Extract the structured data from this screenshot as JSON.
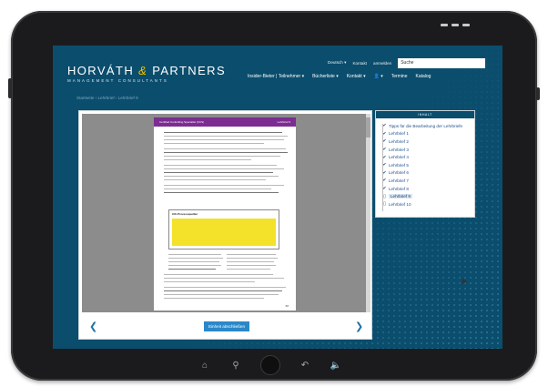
{
  "brand": {
    "name_left": "HORVÁTH",
    "ampersand": "&",
    "name_right": "PARTNERS",
    "tagline": "MANAGEMENT CONSULTANTS"
  },
  "utility": {
    "items": [
      "Deutsch ▾",
      "Kontakt",
      "anmelden"
    ],
    "search_value": "Suche"
  },
  "nav": {
    "items": [
      "Insider-Bieter | Teilnehmer ▾",
      "Bücherliste ▾",
      "Kontakt ▾",
      "👤 ▾",
      "Termine",
      "Katalog"
    ]
  },
  "breadcrumb": "Startseite › Lehrbrief › Lehrbrief 9",
  "document": {
    "header_left": "Certified Controlling Specialist (CCS)",
    "header_right": "Lehrbrief 9",
    "table_title": "CIC-Prozessquellen",
    "page_number": "88"
  },
  "viewer_footer": {
    "prev_icon": "chevron-left",
    "next_icon": "chevron-right",
    "submit_label": "Einheit abschließen"
  },
  "toc": {
    "header": "INHALT",
    "items": [
      {
        "label": "Tipps für die Bearbeitung der Lehrbriefe",
        "checked": true,
        "active": false
      },
      {
        "label": "Lehrbrief 1",
        "checked": true,
        "active": false
      },
      {
        "label": "Lehrbrief 2",
        "checked": true,
        "active": false
      },
      {
        "label": "Lehrbrief 3",
        "checked": true,
        "active": false
      },
      {
        "label": "Lehrbrief 4",
        "checked": true,
        "active": false
      },
      {
        "label": "Lehrbrief 5",
        "checked": true,
        "active": false
      },
      {
        "label": "Lehrbrief 6",
        "checked": true,
        "active": false
      },
      {
        "label": "Lehrbrief 7",
        "checked": true,
        "active": false
      },
      {
        "label": "Lehrbrief 8",
        "checked": true,
        "active": false
      },
      {
        "label": "Lehrbrief 9",
        "checked": false,
        "active": true
      },
      {
        "label": "Lehrbrief 10",
        "checked": false,
        "active": false
      }
    ]
  },
  "bezel": {
    "icons": [
      "home-icon",
      "search-icon",
      "home-button",
      "back-icon",
      "volume-icon"
    ]
  },
  "colors": {
    "screen_bg": "#0b4d6d",
    "accent_blue": "#2a88c9",
    "brand_yellow": "#f2c300",
    "doc_purple": "#7c2d91",
    "table_yellow": "#f3e12a"
  }
}
